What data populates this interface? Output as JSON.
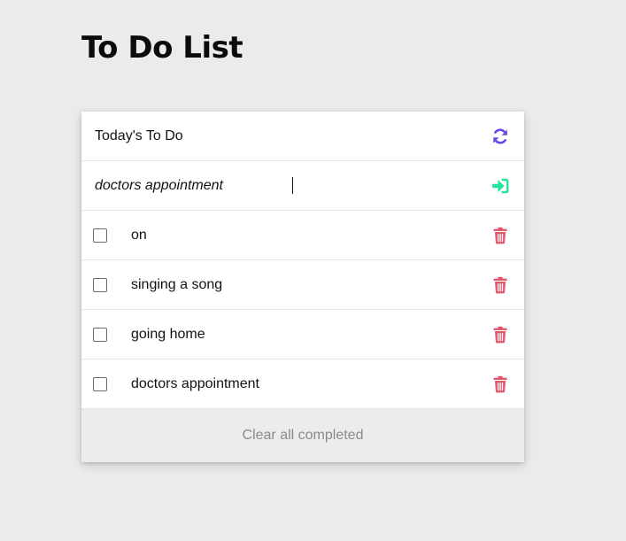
{
  "page": {
    "title": "To Do List"
  },
  "card": {
    "header": {
      "title": "Today's To Do",
      "refresh_icon": "refresh-icon"
    },
    "input": {
      "value": "doctors appointment",
      "submit_icon": "sign-in-icon"
    },
    "items": [
      {
        "label": "on",
        "checked": false,
        "delete_icon": "trash-icon"
      },
      {
        "label": "singing a song",
        "checked": false,
        "delete_icon": "trash-icon"
      },
      {
        "label": "going home",
        "checked": false,
        "delete_icon": "trash-icon"
      },
      {
        "label": "doctors appointment",
        "checked": false,
        "delete_icon": "trash-icon"
      }
    ],
    "footer": {
      "clear_label": "Clear all completed"
    }
  },
  "colors": {
    "background": "#ebebeb",
    "card": "#ffffff",
    "refresh_icon": "#6b48e3",
    "submit_icon": "#28e39a",
    "delete_icon": "#e0596a",
    "footer_text": "#8a8a8a"
  }
}
